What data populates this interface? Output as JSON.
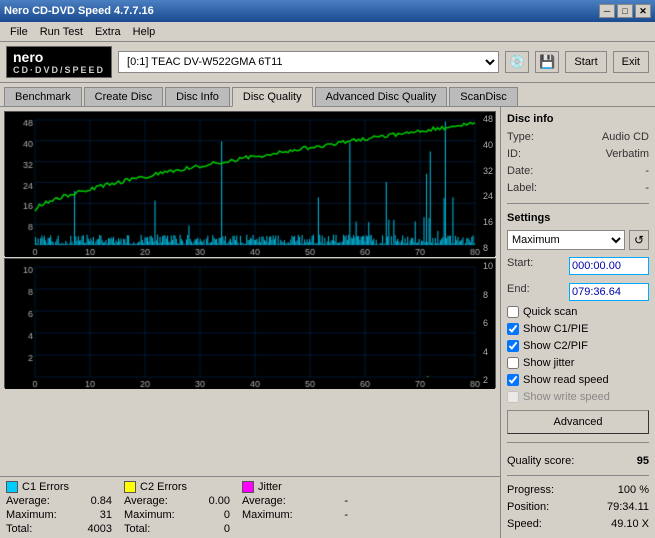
{
  "window": {
    "title": "Nero CD-DVD Speed 4.7.7.16",
    "min_btn": "─",
    "max_btn": "□",
    "close_btn": "✕"
  },
  "menu": {
    "items": [
      "File",
      "Run Test",
      "Extra",
      "Help"
    ]
  },
  "header": {
    "logo_nero": "nero",
    "logo_sub": "CD·DVD/SPEED",
    "drive_label": "[0:1]  TEAC DV-W522GMA 6T11",
    "start_label": "Start",
    "exit_label": "Exit"
  },
  "tabs": {
    "items": [
      "Benchmark",
      "Create Disc",
      "Disc Info",
      "Disc Quality",
      "Advanced Disc Quality",
      "ScanDisc"
    ],
    "active": "Disc Quality"
  },
  "disc_info": {
    "section_title": "Disc info",
    "type_label": "Type:",
    "type_value": "Audio CD",
    "id_label": "ID:",
    "id_value": "Verbatim",
    "date_label": "Date:",
    "date_value": "-",
    "label_label": "Label:",
    "label_value": "-"
  },
  "settings": {
    "section_title": "Settings",
    "speed_value": "Maximum",
    "start_label": "Start:",
    "start_value": "000:00.00",
    "end_label": "End:",
    "end_value": "079:36.64"
  },
  "checkboxes": {
    "quick_scan": {
      "label": "Quick scan",
      "checked": false
    },
    "show_c1_pie": {
      "label": "Show C1/PIE",
      "checked": true
    },
    "show_c2_pif": {
      "label": "Show C2/PIF",
      "checked": true
    },
    "show_jitter": {
      "label": "Show jitter",
      "checked": false
    },
    "show_read_speed": {
      "label": "Show read speed",
      "checked": true
    },
    "show_write_speed": {
      "label": "Show write speed",
      "checked": false
    }
  },
  "advanced_btn": "Advanced",
  "quality": {
    "score_label": "Quality score:",
    "score_value": "95",
    "progress_label": "Progress:",
    "progress_value": "100 %",
    "position_label": "Position:",
    "position_value": "79:34.11",
    "speed_label": "Speed:",
    "speed_value": "49.10 X"
  },
  "stats": {
    "c1_errors": {
      "label": "C1 Errors",
      "color": "#00ccff",
      "average_label": "Average:",
      "average_value": "0.84",
      "maximum_label": "Maximum:",
      "maximum_value": "31",
      "total_label": "Total:",
      "total_value": "4003"
    },
    "c2_errors": {
      "label": "C2 Errors",
      "color": "#ffff00",
      "average_label": "Average:",
      "average_value": "0.00",
      "maximum_label": "Maximum:",
      "maximum_value": "0",
      "total_label": "Total:",
      "total_value": "0"
    },
    "jitter": {
      "label": "Jitter",
      "color": "#ff00ff",
      "average_label": "Average:",
      "average_value": "-",
      "maximum_label": "Maximum:",
      "maximum_value": "-"
    }
  },
  "chart_top": {
    "y_labels": [
      "48",
      "40",
      "32",
      "24",
      "16",
      "8"
    ],
    "x_labels": [
      "0",
      "10",
      "20",
      "30",
      "40",
      "50",
      "60",
      "70",
      "80"
    ]
  },
  "chart_bottom": {
    "y_labels": [
      "10",
      "8",
      "6",
      "4",
      "2"
    ],
    "x_labels": [
      "0",
      "10",
      "20",
      "30",
      "40",
      "50",
      "60",
      "70",
      "80"
    ]
  }
}
